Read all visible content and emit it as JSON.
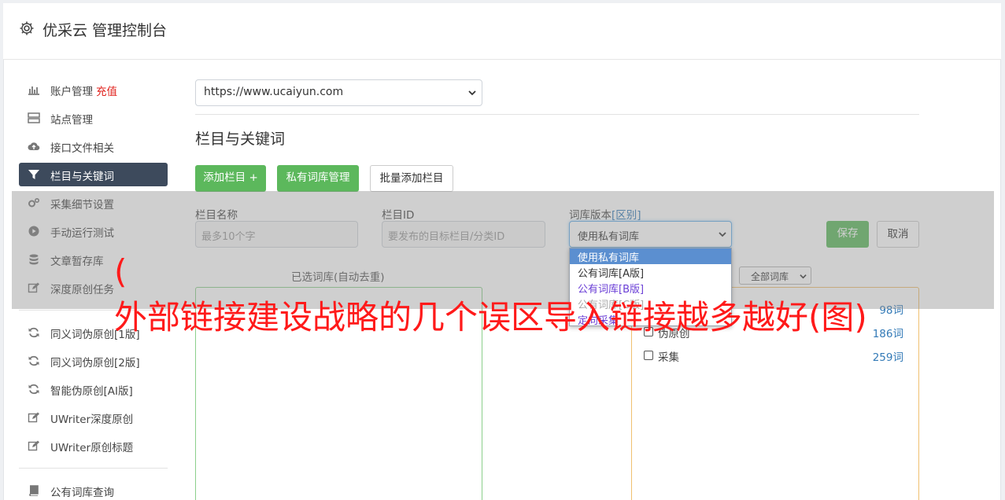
{
  "header": {
    "title": "优采云 管理控制台",
    "icon": "gear-icon"
  },
  "sidebar": {
    "items": [
      {
        "label": "账户管理",
        "extra": "充值",
        "icon": "bar-chart-icon"
      },
      {
        "label": "站点管理",
        "icon": "server-icon"
      },
      {
        "label": "接口文件相关",
        "icon": "cloud-upload-icon"
      },
      {
        "label": "栏目与关键词",
        "icon": "filter-icon",
        "active": true
      },
      {
        "label": "采集细节设置",
        "icon": "cogs-icon"
      },
      {
        "label": "手动运行测试",
        "icon": "play-circle-icon"
      },
      {
        "label": "文章暂存库",
        "icon": "database-icon"
      },
      {
        "label": "深度原创任务",
        "icon": "edit-icon"
      },
      {
        "label": "同义词伪原创[1版]",
        "icon": "refresh-icon"
      },
      {
        "label": "同义词伪原创[2版]",
        "icon": "refresh-icon"
      },
      {
        "label": "智能伪原创[AI版]",
        "icon": "refresh-icon"
      },
      {
        "label": "UWriter深度原创",
        "icon": "edit-icon"
      },
      {
        "label": "UWriter原创标题",
        "icon": "edit-icon"
      },
      {
        "label": "公有词库查询",
        "icon": "book-icon"
      }
    ]
  },
  "main": {
    "site_select": "https://www.ucaiyun.com",
    "section_title": "栏目与关键词",
    "buttons": {
      "add_column": "添加栏目 +",
      "private_lib": "私有词库管理",
      "batch_add": "批量添加栏目"
    },
    "form": {
      "col_name_label": "栏目名称",
      "col_name_placeholder": "最多10个字",
      "col_id_label": "栏目ID",
      "col_id_placeholder": "要发布的目标栏目/分类ID",
      "lib_version_label": "词库版本",
      "lib_version_link": "[区别]",
      "lib_version_value": "使用私有词库",
      "save": "保存",
      "cancel": "取消"
    },
    "dropdown_options": [
      "使用私有词库",
      "公有词库[A版]",
      "公有词库[B版]",
      "公有词库[C版]",
      "定向采集"
    ],
    "selected_lib_label": "已选词库(自动去重)",
    "filter_select": "全部词库",
    "libraries": [
      {
        "name": "",
        "count": "98词"
      },
      {
        "name": "伪原创",
        "count": "186词"
      },
      {
        "name": "采集",
        "count": "259词"
      }
    ]
  },
  "watermark": {
    "paren": "(",
    "text": "外部链接建设战略的几个误区导入链接越多越好(图)"
  },
  "colors": {
    "accent_green": "#5cb85c",
    "active_nav": "#3d4a5c",
    "link_blue": "#337ab7",
    "watermark_red": "#ff1a1a"
  }
}
